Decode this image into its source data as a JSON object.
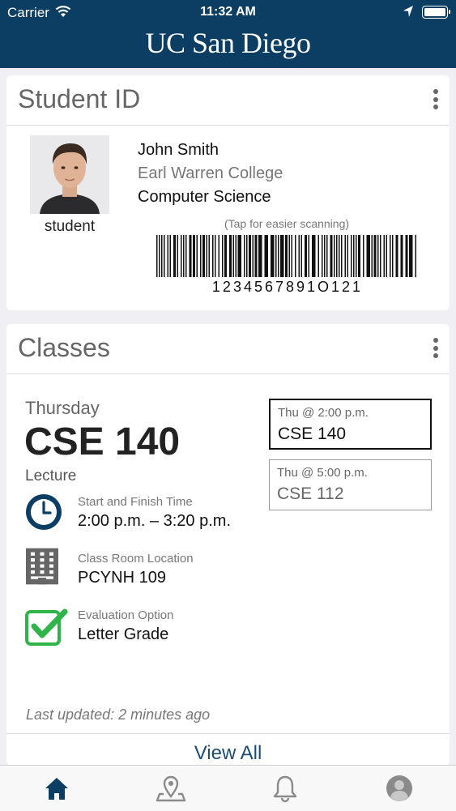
{
  "status_bar": {
    "carrier": "Carrier",
    "time": "11:32 AM"
  },
  "header": {
    "brand": "UC San Diego"
  },
  "student_id": {
    "title": "Student ID",
    "photo_label": "student",
    "name": "John Smith",
    "college": "Earl Warren College",
    "major": "Computer Science",
    "tap_hint": "(Tap for easier scanning)",
    "barcode_number": "1234567891O121"
  },
  "classes": {
    "title": "Classes",
    "day": "Thursday",
    "course": "CSE 140",
    "type": "Lecture",
    "time_caption": "Start and Finish Time",
    "time_value": "2:00 p.m. – 3:20 p.m.",
    "location_caption": "Class Room Location",
    "location_value": "PCYNH 109",
    "evaluation_caption": "Evaluation Option",
    "evaluation_value": "Letter Grade",
    "schedule": [
      {
        "time": "Thu @ 2:00 p.m.",
        "course": "CSE 140"
      },
      {
        "time": "Thu @ 5:00 p.m.",
        "course": "CSE 112"
      }
    ],
    "last_updated": "Last updated: 2 minutes ago",
    "view_all": "View All"
  },
  "tab_bar": {
    "items": [
      {
        "icon": "home-icon",
        "active": true
      },
      {
        "icon": "map-pin-icon",
        "active": false
      },
      {
        "icon": "bell-icon",
        "active": false
      },
      {
        "icon": "profile-icon",
        "active": false
      }
    ]
  },
  "colors": {
    "brand_navy": "#0b3e62",
    "check_green": "#2fb44a",
    "link_blue": "#1c4e73"
  }
}
